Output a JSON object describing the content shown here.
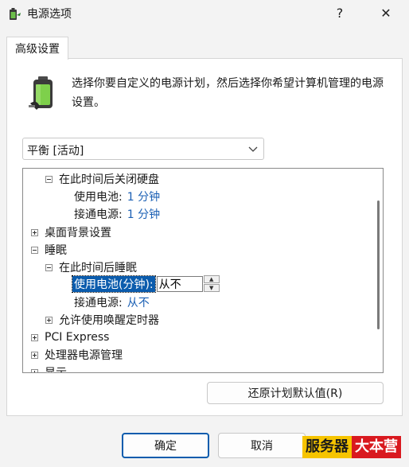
{
  "window": {
    "title": "电源选项",
    "help_label": "?",
    "close_label": "✕"
  },
  "tab": {
    "label": "高级设置"
  },
  "description": "选择你要自定义的电源计划，然后选择你希望计算机管理的电源设置。",
  "plan_select": {
    "value": "平衡 [活动]"
  },
  "tree": {
    "hdd_off": "在此时间后关闭硬盘",
    "battery_label": "使用电池:",
    "battery_value": "1 分钟",
    "plugged_label": "接通电源:",
    "plugged_value": "1 分钟",
    "desktop_bg": "桌面背景设置",
    "sleep": "睡眠",
    "sleep_after": "在此时间后睡眠",
    "sleep_battery_label": "使用电池(分钟):",
    "sleep_battery_value": "从不",
    "sleep_plugged_label": "接通电源:",
    "sleep_plugged_value": "从不",
    "wake_timers": "允许使用唤醒定时器",
    "pci_express": "PCI Express",
    "cpu_power": "处理器电源管理",
    "display": "显示"
  },
  "buttons": {
    "restore": "还原计划默认值(R)",
    "ok": "确定",
    "cancel": "取消"
  },
  "watermark": {
    "part1": "服务器",
    "part2": "大本营"
  },
  "colors": {
    "accent": "#0b5cad",
    "value_text": "#1a5fb4"
  }
}
